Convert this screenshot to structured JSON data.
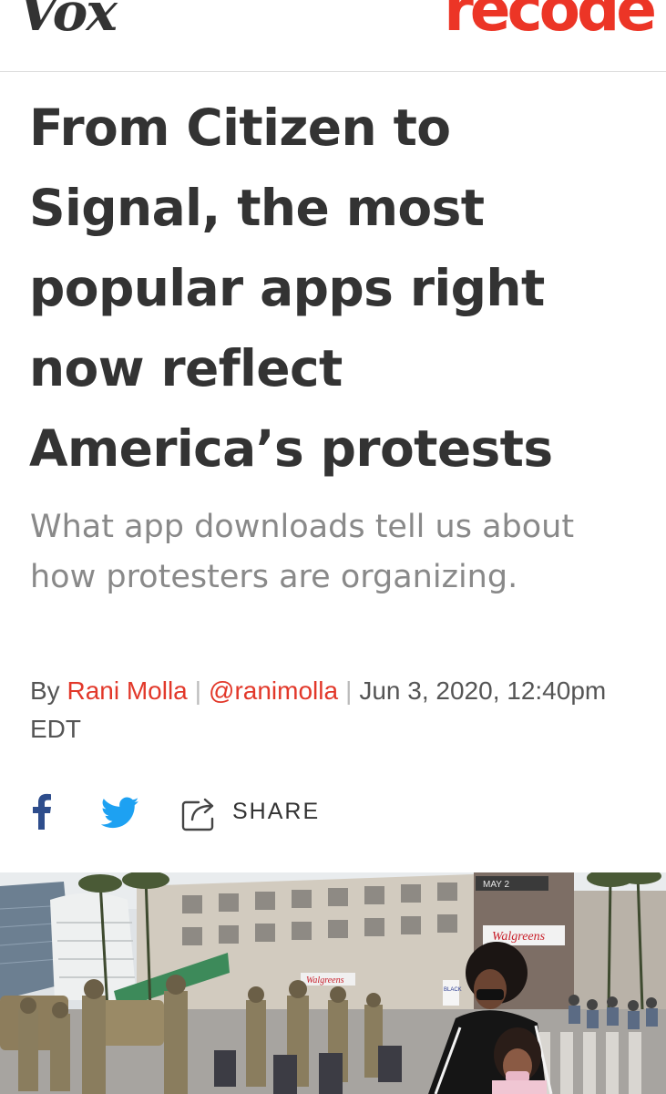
{
  "header": {
    "vox_logo": "Vox",
    "recode_logo": "recode"
  },
  "article": {
    "headline": "From Citizen to Signal, the most popular apps right now reflect America’s protests",
    "dek": "What app downloads tell us about how protesters are organizing.",
    "byline": {
      "by": "By",
      "author": "Rani Molla",
      "handle": "@ranimolla",
      "date": "Jun 3, 2020, 12:40pm EDT",
      "separator": "|"
    }
  },
  "share": {
    "facebook_icon": "facebook-icon",
    "twitter_icon": "twitter-icon",
    "share_icon": "share-icon",
    "share_label": "SHARE"
  },
  "photo": {
    "signs": [
      "MAY 2",
      "Walgreens",
      "Walgreens",
      "BLACK"
    ]
  },
  "colors": {
    "accent": "#e2382a",
    "recode": "#ec3526",
    "facebook": "#2e4d8c",
    "twitter": "#1da1f2",
    "text": "#333333",
    "dek": "#898989"
  }
}
